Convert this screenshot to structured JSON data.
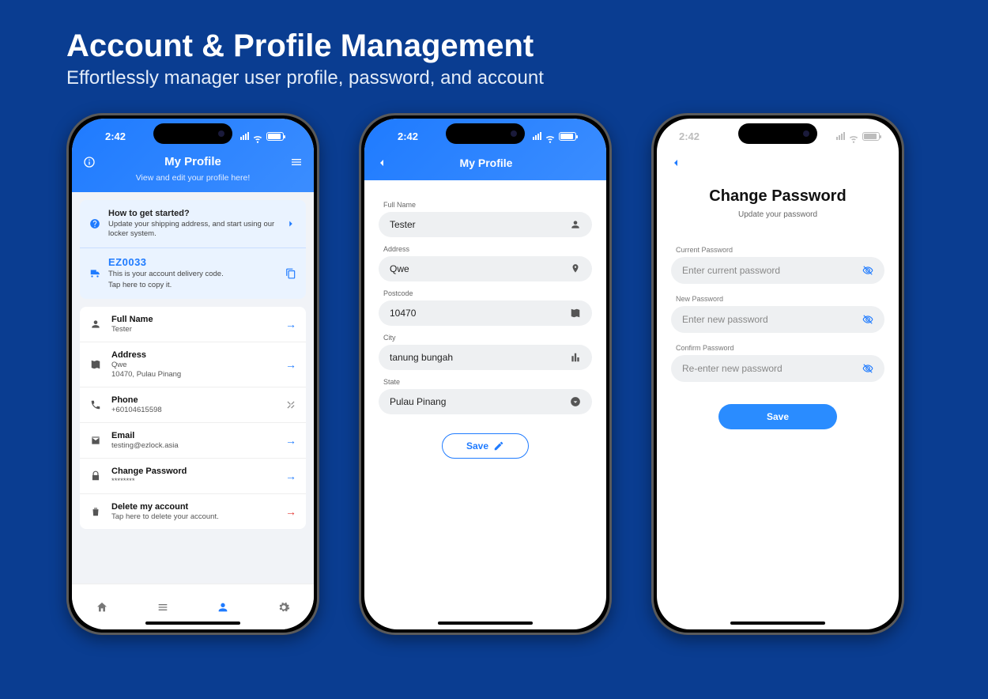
{
  "page": {
    "title": "Account & Profile Management",
    "subtitle": "Effortlessly manager user profile, password, and account"
  },
  "status_time": "2:42",
  "screen1": {
    "header_title": "My Profile",
    "header_subtitle": "View and edit your profile here!",
    "tip": {
      "title": "How to get started?",
      "text": "Update your shipping address, and start using our locker system."
    },
    "delivery": {
      "code": "EZ0033",
      "text1": "This is your account delivery code.",
      "text2": "Tap here to copy it."
    },
    "rows": {
      "fullname_label": "Full Name",
      "fullname_value": "Tester",
      "address_label": "Address",
      "address_value1": "Qwe",
      "address_value2": "10470, Pulau Pinang",
      "phone_label": "Phone",
      "phone_value": "+60104615598",
      "email_label": "Email",
      "email_value": "testing@ezlock.asia",
      "change_pw_label": "Change Password",
      "change_pw_value": "********",
      "delete_label": "Delete my account",
      "delete_value": "Tap here to delete your account."
    }
  },
  "screen2": {
    "header_title": "My Profile",
    "fields": {
      "fullname_label": "Full Name",
      "fullname_value": "Tester",
      "address_label": "Address",
      "address_value": "Qwe",
      "postcode_label": "Postcode",
      "postcode_value": "10470",
      "city_label": "City",
      "city_value": "tanung bungah",
      "state_label": "State",
      "state_value": "Pulau Pinang"
    },
    "save_label": "Save"
  },
  "screen3": {
    "title": "Change Password",
    "subtitle": "Update your password",
    "current_label": "Current Password",
    "current_ph": "Enter current password",
    "new_label": "New Password",
    "new_ph": "Enter new password",
    "confirm_label": "Confirm Password",
    "confirm_ph": "Re-enter new password",
    "save_label": "Save"
  }
}
